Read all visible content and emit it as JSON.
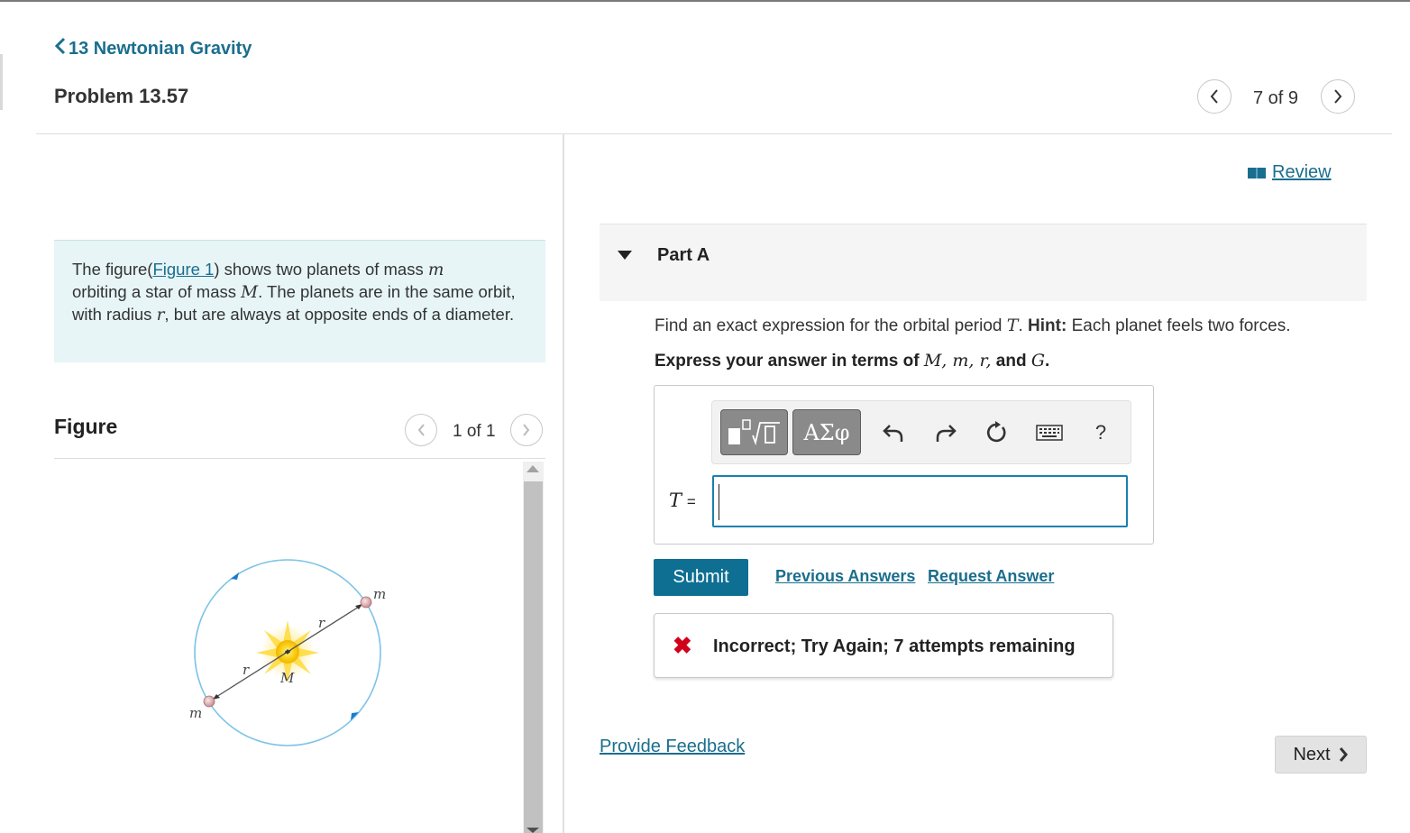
{
  "header": {
    "back_label": "13 Newtonian Gravity",
    "problem_title": "Problem 13.57",
    "pager": "7 of 9"
  },
  "problem": {
    "text_part1": "The figure(",
    "figure_link": "Figure 1",
    "text_part2": ") shows two planets of mass ",
    "sym_m": "m",
    "text_part3": " orbiting a star of mass ",
    "sym_M": "M",
    "text_part4": ". The planets are in the same orbit, with radius ",
    "sym_r": "r",
    "text_part5": ", but are always at opposite ends of a diameter."
  },
  "figure": {
    "title": "Figure",
    "counter": "1 of 1",
    "labels": {
      "m_top": "m",
      "m_bottom": "m",
      "r_top": "r",
      "r_bottom": "r",
      "M": "M"
    }
  },
  "review": {
    "label": "Review"
  },
  "part": {
    "title": "Part A",
    "question_pre": "Find an exact expression for the orbital period ",
    "question_sym": "T",
    "question_mid": ". ",
    "hint_label": "Hint:",
    "hint_text": " Each planet feels two forces.",
    "express_pre": "Express your answer in terms of ",
    "express_vars": "M, m, r,",
    "express_and": " and ",
    "express_G": "G",
    "express_end": "."
  },
  "toolbar": {
    "greek_label": "ΑΣφ",
    "help_label": "?"
  },
  "answer": {
    "var_label": "T",
    "equals": "=",
    "value": ""
  },
  "actions": {
    "submit": "Submit",
    "previous_answers": "Previous Answers",
    "request_answer": "Request Answer"
  },
  "feedback": {
    "icon": "✖",
    "text": "Incorrect; Try Again; 7 attempts remaining"
  },
  "footer": {
    "provide_feedback": "Provide Feedback",
    "next": "Next"
  },
  "colors": {
    "link": "#1a6e8e",
    "submit_bg": "#0e6f92",
    "problem_bg": "#e7f5f7",
    "error": "#d0021b"
  }
}
